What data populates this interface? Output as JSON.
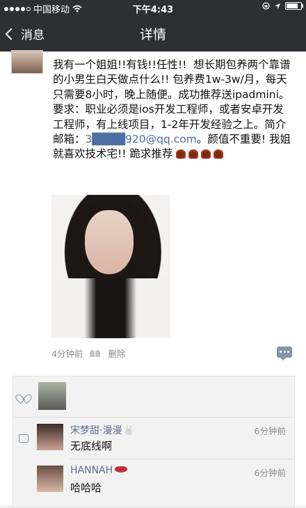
{
  "status_bar": {
    "carrier": "中国移动",
    "time": "下午4:43"
  },
  "nav": {
    "back_label": "消息",
    "title": "详情"
  },
  "post": {
    "text_before_email": "我有一个姐姐!!有钱!!任性!!  想长期包养两个靠谱的小男生白天做点什么!! 包养费1w-3w/月，每天只需要8小时，晚上随便。成功推荐送ipadmini。\n要求：职业必须是ios开发工程师，或者安卓开发工程师，有上线项目，1-2年开发经验之上。简介邮箱：",
    "email": "3████920@qq.com",
    "text_after_email": "。颜值不重要! 我姐就喜欢技术宅!!  跪求推荐",
    "time": "4分钟前",
    "delete_label": "删除"
  },
  "comments": [
    {
      "name": "宋梦甜·漫漫",
      "time": "6分钟前",
      "text": "无底线啊"
    },
    {
      "name": "HANNAH",
      "time": "6分钟前",
      "text": "哈哈哈"
    }
  ],
  "icons": {
    "signal": "signal-dots-icon",
    "wifi": "wifi-icon",
    "back": "chevron-left-icon",
    "like": "heart-icon",
    "comment": "comment-icon",
    "reply": "comment-bubble-icon"
  }
}
